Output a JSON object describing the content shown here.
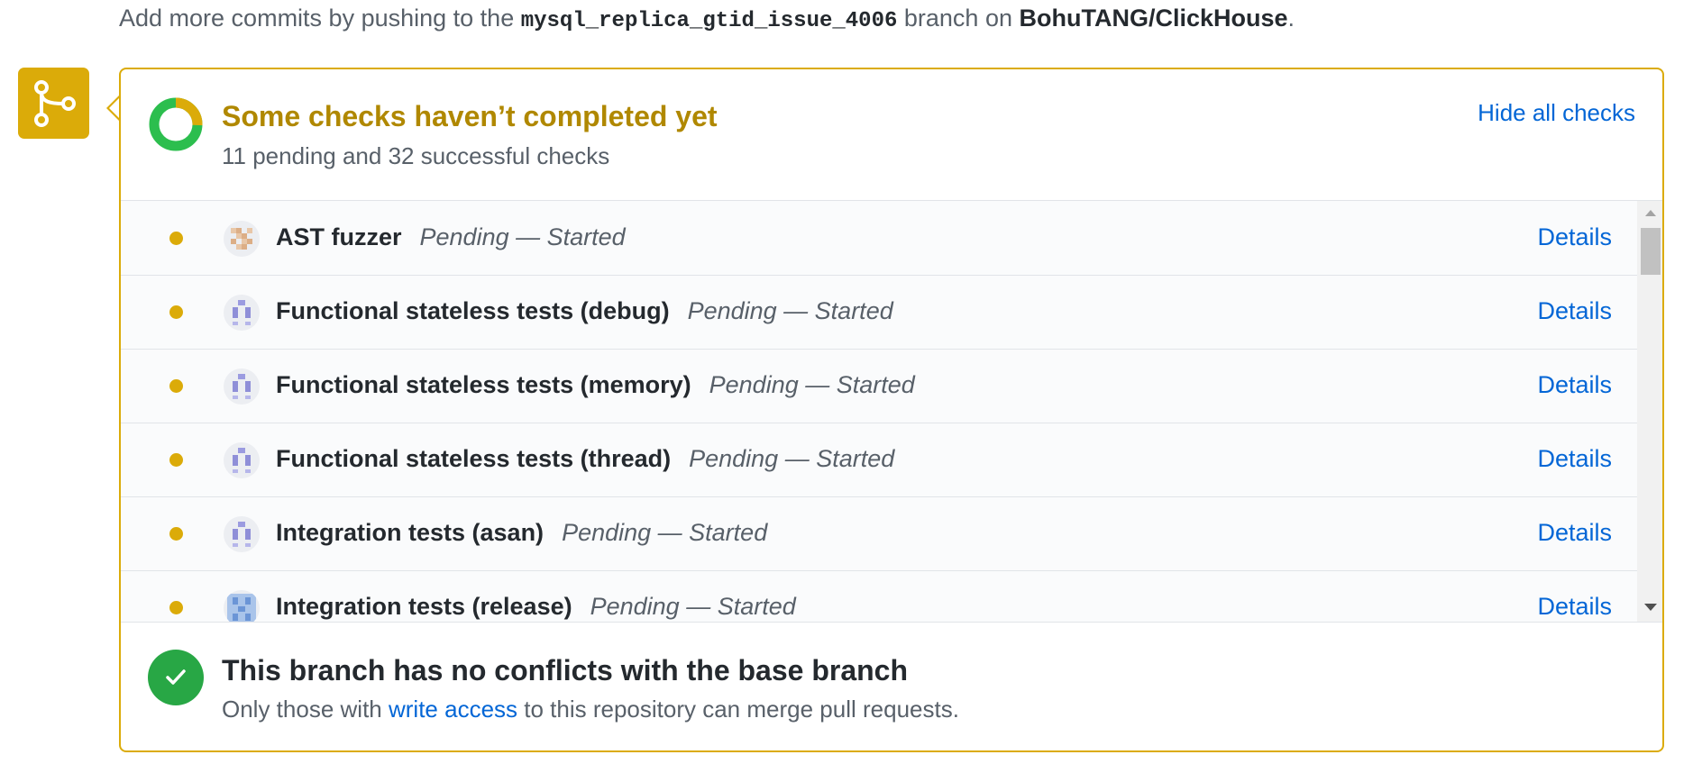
{
  "hint": {
    "prefix": "Add more commits by pushing to the ",
    "branch": "mysql_replica_gtid_issue_4006",
    "middle": " branch on ",
    "repo": "BohuTANG/ClickHouse",
    "suffix": "."
  },
  "status": {
    "title": "Some checks haven’t completed yet",
    "subtitle": "11 pending and 32 successful checks",
    "hide_link": "Hide all checks",
    "pending_count": 11,
    "success_count": 32,
    "colors": {
      "pending": "#dbab09",
      "success": "#2cbe4e",
      "title": "#b08800"
    }
  },
  "checks": [
    {
      "name": "AST fuzzer",
      "status": "Pending — Started",
      "details": "Details",
      "avatar": "ast-fuzzer-avatar-icon"
    },
    {
      "name": "Functional stateless tests (debug)",
      "status": "Pending — Started",
      "details": "Details",
      "avatar": "bot-avatar-icon"
    },
    {
      "name": "Functional stateless tests (memory)",
      "status": "Pending — Started",
      "details": "Details",
      "avatar": "bot-avatar-icon"
    },
    {
      "name": "Functional stateless tests (thread)",
      "status": "Pending — Started",
      "details": "Details",
      "avatar": "bot-avatar-icon"
    },
    {
      "name": "Integration tests (asan)",
      "status": "Pending — Started",
      "details": "Details",
      "avatar": "bot-avatar-icon"
    },
    {
      "name": "Integration tests (release)",
      "status": "Pending — Started",
      "details": "Details",
      "avatar": "bot-avatar-icon"
    }
  ],
  "merge": {
    "title": "This branch has no conflicts with the base branch",
    "sub_prefix": "Only those with ",
    "sub_link": "write access",
    "sub_suffix": " to this repository can merge pull requests."
  }
}
